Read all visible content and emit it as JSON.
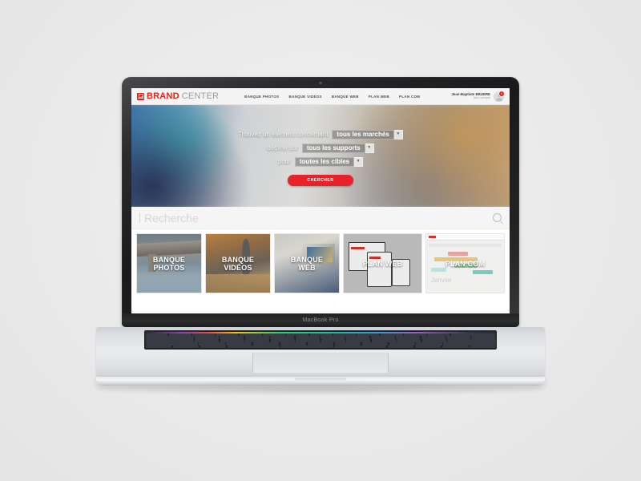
{
  "scene": {
    "device_label": "MacBook Pro"
  },
  "site": {
    "header": {
      "logo": {
        "brand": "BRAND",
        "center": "CENTER",
        "mark_icon": "brand-square-icon"
      },
      "nav": [
        {
          "label": "BANQUE PHOTOS"
        },
        {
          "label": "BANQUE VIDÉOS"
        },
        {
          "label": "BANQUE WEB"
        },
        {
          "label": "PLAN WEB"
        },
        {
          "label": "PLAN COM"
        }
      ],
      "user": {
        "name": "Jean-Baptiste BRUERE",
        "subtitle": "Mon compte",
        "badge_count": "0",
        "avatar_icon": "user-avatar-icon"
      }
    },
    "hero": {
      "line1_prefix": "Trouvez un élément concernant",
      "select_market": {
        "value": "tous les marchés",
        "arrow_icon": "chevron-down-icon"
      },
      "line2_prefix": "décliné sur",
      "select_support": {
        "value": "tous les supports",
        "arrow_icon": "chevron-down-icon"
      },
      "line3_prefix": "pour",
      "select_target": {
        "value": "toutes les cibles",
        "arrow_icon": "chevron-down-icon"
      },
      "cta_label": "CHERCHER",
      "cta_color": "#e8222a"
    },
    "search": {
      "placeholder": "Recherche",
      "value": "",
      "icon": "search-icon"
    },
    "tiles": [
      {
        "label": "BANQUE\nPHOTOS"
      },
      {
        "label": "BANQUE\nVIDÉOS"
      },
      {
        "label": "BANQUE\nWEB"
      },
      {
        "label": "PLAN WEB"
      },
      {
        "label": "PLAN COM"
      }
    ],
    "tile_art": {
      "plancom_month": "Janvier"
    },
    "colors": {
      "brand_red": "#e2231a",
      "header_bg": "#f4f4f4",
      "search_bg": "#f5f5f5"
    }
  }
}
